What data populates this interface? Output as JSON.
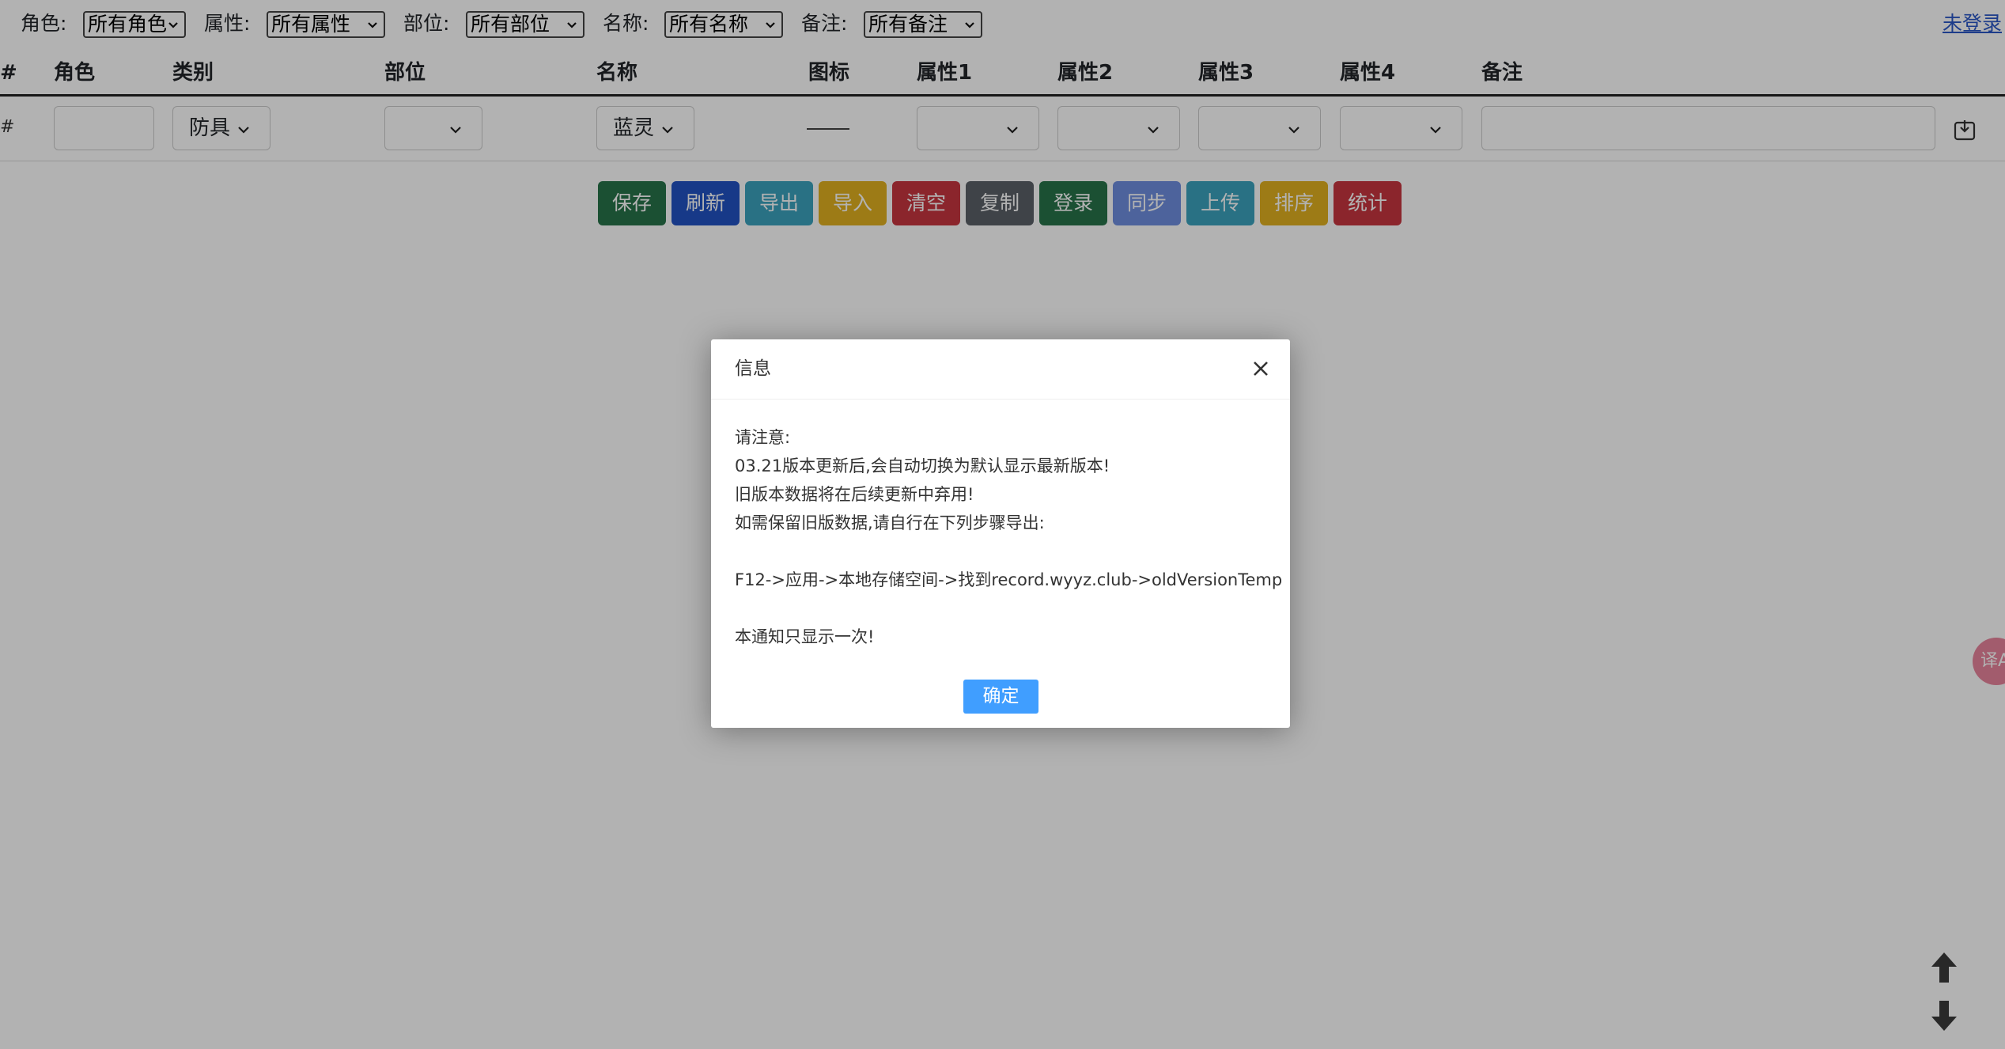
{
  "filters": {
    "role_label": "角色:",
    "role_value": "所有角色",
    "attr_label": "属性:",
    "attr_value": "所有属性",
    "part_label": "部位:",
    "part_value": "所有部位",
    "name_label": "名称:",
    "name_value": "所有名称",
    "note_label": "备注:",
    "note_value": "所有备注",
    "login_link": "未登录"
  },
  "table": {
    "headers": [
      "#",
      "角色",
      "类别",
      "部位",
      "名称",
      "图标",
      "属性1",
      "属性2",
      "属性3",
      "属性4",
      "备注"
    ],
    "row": {
      "hash": "#",
      "category": "防具",
      "part": "",
      "name": "蓝灵",
      "icon_placeholder": "——"
    }
  },
  "buttons": [
    {
      "label": "保存",
      "color": "#28734a"
    },
    {
      "label": "刷新",
      "color": "#2252c3"
    },
    {
      "label": "导出",
      "color": "#3ba3bd"
    },
    {
      "label": "导入",
      "color": "#e1b120"
    },
    {
      "label": "清空",
      "color": "#c83640"
    },
    {
      "label": "复制",
      "color": "#5b6168"
    },
    {
      "label": "登录",
      "color": "#28734a"
    },
    {
      "label": "同步",
      "color": "#6f8fe0"
    },
    {
      "label": "上传",
      "color": "#3ba3bd"
    },
    {
      "label": "排序",
      "color": "#e1b120"
    },
    {
      "label": "统计",
      "color": "#c83640"
    }
  ],
  "modal": {
    "title": "信息",
    "lines": [
      "请注意:",
      "03.21版本更新后,会自动切换为默认显示最新版本!",
      "旧版本数据将在后续更新中弃用!",
      "如需保留旧版数据,请自行在下列步骤导出:",
      "",
      "F12->应用->本地存储空间->找到record.wyyz.club->oldVersionTemp",
      "",
      "本通知只显示一次!"
    ],
    "ok_label": "确定"
  },
  "widgets": {
    "translate_icon": "translate-icon",
    "translate_text": "译A",
    "scroll_up_icon": "arrow-up-icon",
    "scroll_down_icon": "arrow-down-icon"
  }
}
